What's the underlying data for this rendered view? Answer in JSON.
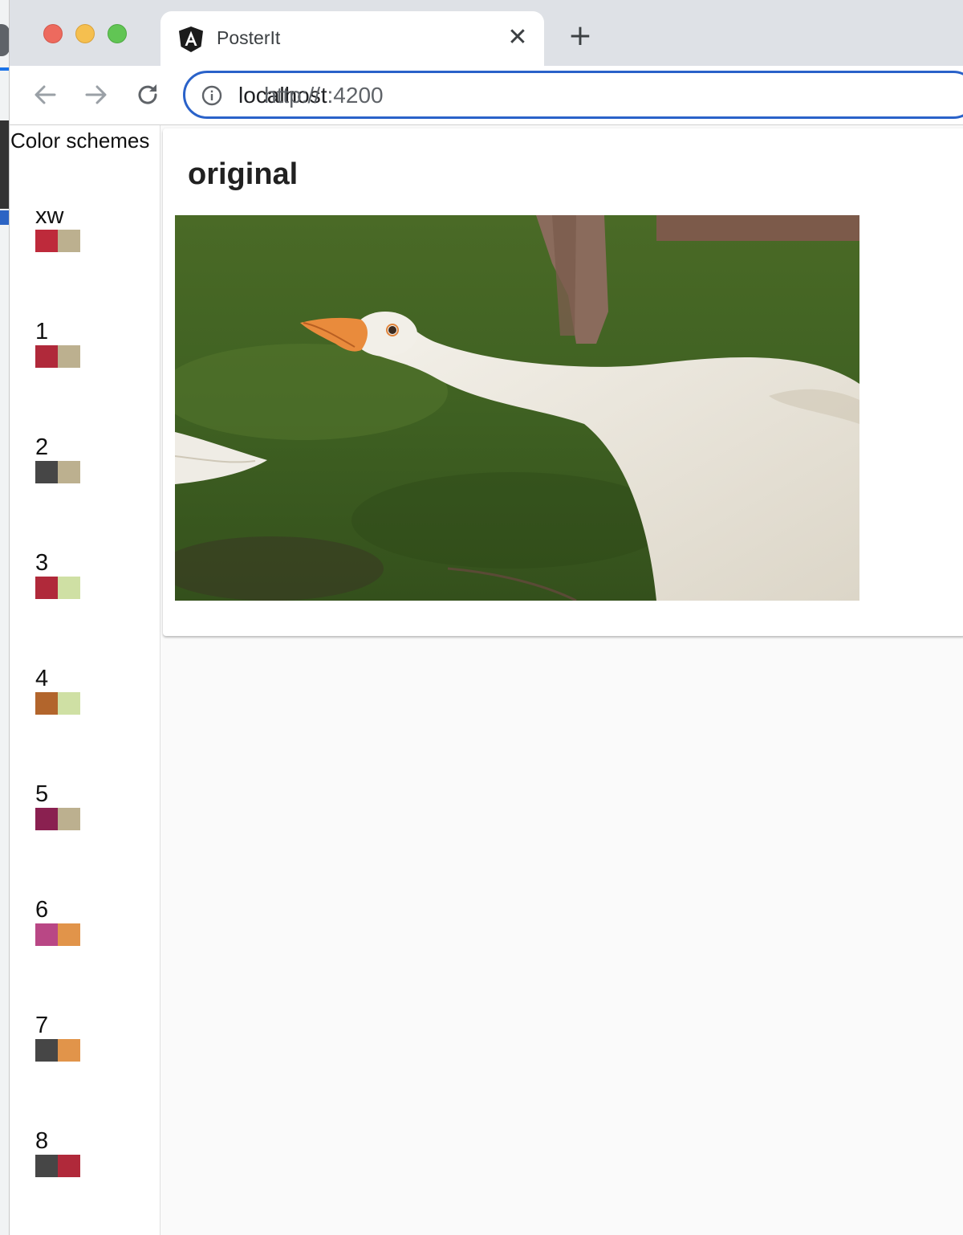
{
  "browser": {
    "tab_title": "PosterIt",
    "close_glyph": "✕",
    "new_tab_glyph": "+",
    "url_scheme": "http://",
    "url_host": "localhost",
    "url_port": ":4200",
    "icons": [
      "angular-favicon",
      "back-arrow-icon",
      "forward-arrow-icon",
      "reload-icon",
      "info-icon",
      "close-icon",
      "plus-icon"
    ]
  },
  "sidebar": {
    "title": "Color schemes",
    "schemes": [
      {
        "label": "xw",
        "colors": [
          "#be2a3b",
          "#bcb08f"
        ]
      },
      {
        "label": "1",
        "colors": [
          "#b0293a",
          "#bcb08f"
        ]
      },
      {
        "label": "2",
        "colors": [
          "#464646",
          "#bcb08f"
        ]
      },
      {
        "label": "3",
        "colors": [
          "#b0293a",
          "#cfe0a4"
        ]
      },
      {
        "label": "4",
        "colors": [
          "#b2652c",
          "#cfe0a4"
        ]
      },
      {
        "label": "5",
        "colors": [
          "#8a2050",
          "#bcb08f"
        ]
      },
      {
        "label": "6",
        "colors": [
          "#b94785",
          "#e1944a"
        ]
      },
      {
        "label": "7",
        "colors": [
          "#464646",
          "#e1944a"
        ]
      },
      {
        "label": "8",
        "colors": [
          "#464646",
          "#b0293a"
        ]
      }
    ]
  },
  "main": {
    "card_title": "original",
    "image_alt": "White goose stretching its neck on green grass"
  }
}
